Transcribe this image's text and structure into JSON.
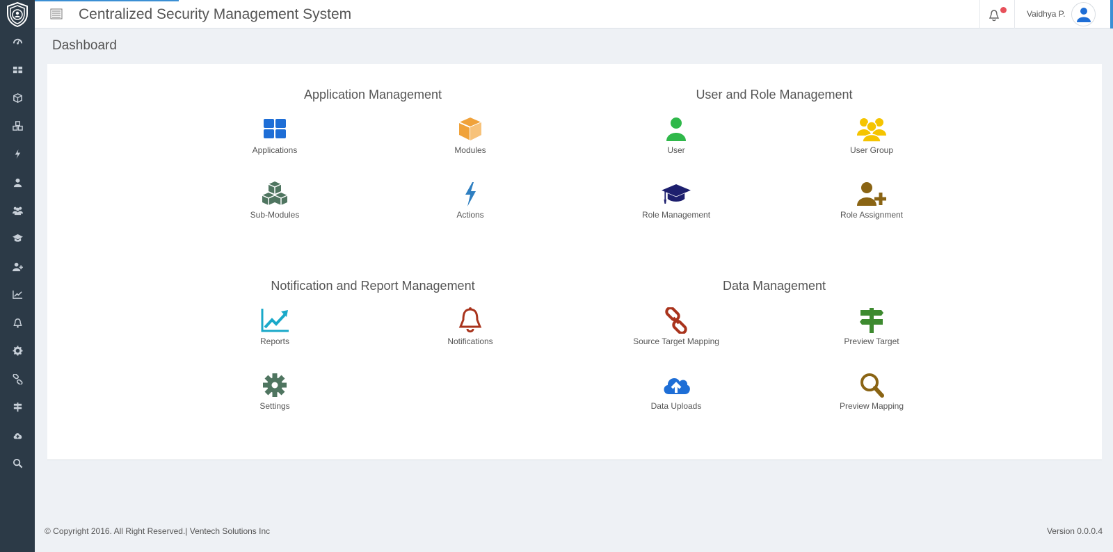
{
  "header": {
    "title": "Centralized Security Management System",
    "user_name": "Vaidhya P.",
    "notification_dot_color": "#e7505a",
    "accent_color": "#3b8fd4"
  },
  "sidebar": {
    "items": [
      {
        "icon": "dashboard-icon"
      },
      {
        "icon": "applications-grid-icon"
      },
      {
        "icon": "cube-icon"
      },
      {
        "icon": "cubes-icon"
      },
      {
        "icon": "bolt-icon"
      },
      {
        "icon": "user-icon"
      },
      {
        "icon": "users-icon"
      },
      {
        "icon": "graduation-cap-icon"
      },
      {
        "icon": "user-plus-icon"
      },
      {
        "icon": "line-chart-icon"
      },
      {
        "icon": "bell-icon"
      },
      {
        "icon": "gear-icon"
      },
      {
        "icon": "link-icon"
      },
      {
        "icon": "signpost-icon"
      },
      {
        "icon": "cloud-upload-icon"
      },
      {
        "icon": "search-icon"
      }
    ]
  },
  "page": {
    "title": "Dashboard"
  },
  "sections": {
    "application": {
      "title": "Application Management",
      "tiles": [
        {
          "label": "Applications",
          "icon": "th-large-icon",
          "color": "#1e6ed6"
        },
        {
          "label": "Modules",
          "icon": "cube-icon",
          "color": "#f0a23a"
        },
        {
          "label": "Sub-Modules",
          "icon": "cubes-icon",
          "color": "#4f7560"
        },
        {
          "label": "Actions",
          "icon": "bolt-icon",
          "color": "#2f7fc1"
        }
      ]
    },
    "user_role": {
      "title": "User and Role Management",
      "tiles": [
        {
          "label": "User",
          "icon": "user-icon",
          "color": "#2fb84a"
        },
        {
          "label": "User Group",
          "icon": "users-icon",
          "color": "#f5c400"
        },
        {
          "label": "Role Management",
          "icon": "graduation-cap-icon",
          "color": "#1d1f6e"
        },
        {
          "label": "Role Assignment",
          "icon": "user-plus-icon",
          "color": "#8a6414"
        }
      ]
    },
    "notification_report": {
      "title": "Notification and Report Management",
      "tiles": [
        {
          "label": "Reports",
          "icon": "line-chart-icon",
          "color": "#1aa9c9"
        },
        {
          "label": "Notifications",
          "icon": "bell-icon",
          "color": "#a9331c"
        },
        {
          "label": "Settings",
          "icon": "gear-icon",
          "color": "#4f7560"
        }
      ]
    },
    "data": {
      "title": "Data Management",
      "tiles": [
        {
          "label": "Source Target Mapping",
          "icon": "link-icon",
          "color": "#a9331c"
        },
        {
          "label": "Preview Target",
          "icon": "signpost-icon",
          "color": "#3d8a2f"
        },
        {
          "label": "Data Uploads",
          "icon": "cloud-upload-icon",
          "color": "#1e6ed6"
        },
        {
          "label": "Preview Mapping",
          "icon": "search-icon",
          "color": "#8a6414"
        }
      ]
    }
  },
  "footer": {
    "copyright": "© Copyright 2016. All Right Reserved.| Ventech Solutions Inc",
    "version": "Version 0.0.0.4"
  }
}
